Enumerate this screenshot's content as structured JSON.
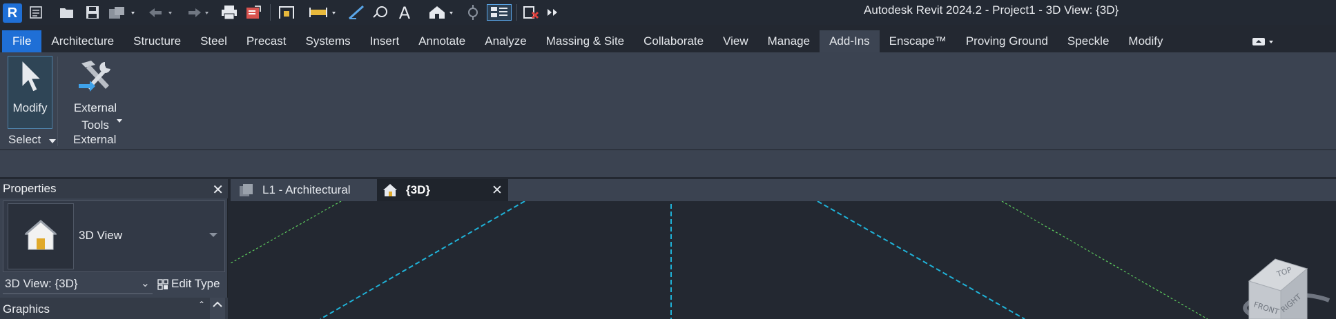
{
  "app": {
    "title": "Autodesk Revit 2024.2 - Project1 - 3D View: {3D}",
    "logo_letter": "R"
  },
  "ribbon": {
    "tabs": [
      {
        "label": "File"
      },
      {
        "label": "Architecture"
      },
      {
        "label": "Structure"
      },
      {
        "label": "Steel"
      },
      {
        "label": "Precast"
      },
      {
        "label": "Systems"
      },
      {
        "label": "Insert"
      },
      {
        "label": "Annotate"
      },
      {
        "label": "Analyze"
      },
      {
        "label": "Massing & Site"
      },
      {
        "label": "Collaborate"
      },
      {
        "label": "View"
      },
      {
        "label": "Manage"
      },
      {
        "label": "Add-Ins"
      },
      {
        "label": "Enscape™"
      },
      {
        "label": "Proving Ground"
      },
      {
        "label": "Speckle"
      },
      {
        "label": "Modify"
      }
    ],
    "active_tab": "Add-Ins",
    "modify_label": "Modify",
    "select_label": "Select",
    "external_tools_line1": "External",
    "external_tools_line2": "Tools",
    "external_panel_label": "External"
  },
  "properties": {
    "title": "Properties",
    "type_name": "3D View",
    "view_selector": "3D View: {3D}",
    "edit_type": "Edit Type",
    "section": "Graphics"
  },
  "view_tabs": [
    {
      "label": "L1 - Architectural",
      "active": false
    },
    {
      "label": "{3D}",
      "active": true
    }
  ],
  "navcube": {
    "top": "TOP",
    "front": "FRONT",
    "right": "RIGHT"
  },
  "colors": {
    "file_tab": "#1f6fd6",
    "background": "#232831",
    "ribbon": "#3b4351",
    "guide_cyan": "#1fb3d9",
    "guide_green": "#5fcf5f"
  }
}
